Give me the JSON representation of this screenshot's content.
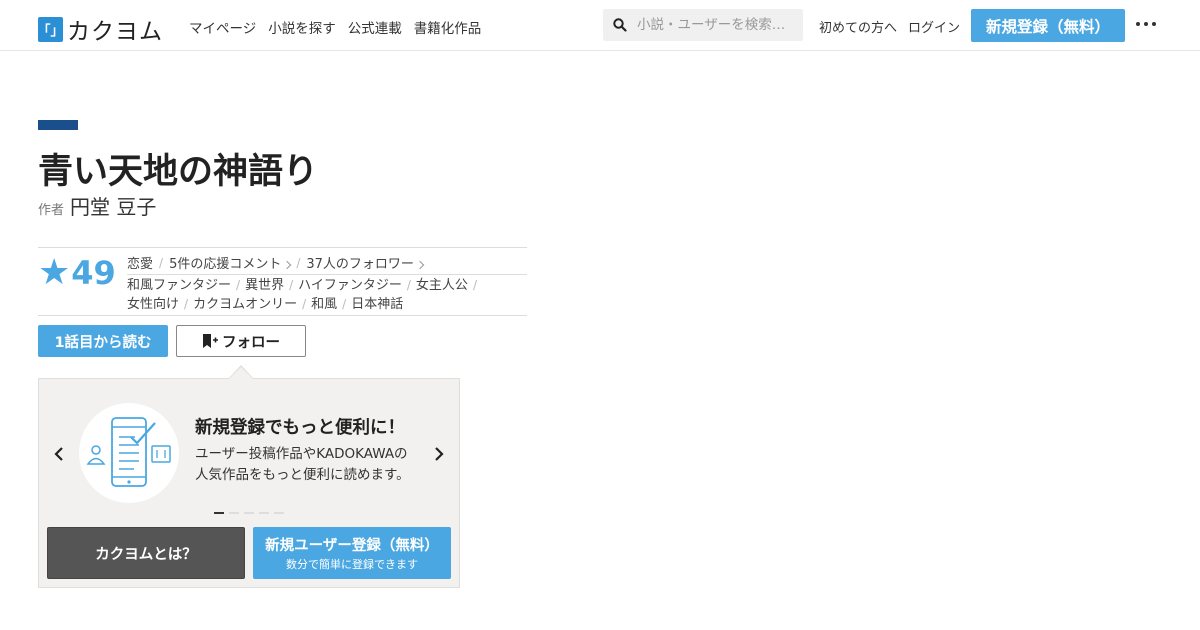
{
  "header": {
    "logo_mark": "「」",
    "logo_text": "カクヨム",
    "nav": [
      {
        "label": "マイページ"
      },
      {
        "label": "小説を探す"
      },
      {
        "label": "公式連載"
      },
      {
        "label": "書籍化作品"
      }
    ],
    "search_placeholder": "小説・ユーザーを検索…",
    "first_time": "初めての方へ",
    "login": "ログイン",
    "signup": "新規登録（無料）"
  },
  "work": {
    "title": "青い天地の神語り",
    "author_label": "作者",
    "author_name": "円堂 豆子",
    "star_count": "49",
    "genre": "恋愛",
    "comments": "5件の応援コメント",
    "followers": "37人のフォロワー",
    "tags": [
      "和風ファンタジー",
      "異世界",
      "ハイファンタジー",
      "女主人公",
      "女性向け",
      "カクヨムオンリー",
      "和風",
      "日本神話"
    ],
    "read_button": "1話目から読む",
    "follow_button": "フォロー"
  },
  "promo": {
    "title": "新規登録でもっと便利に！",
    "desc_line1": "ユーザー投稿作品やKADOKAWAの",
    "desc_line2": "人気作品をもっと便利に読めます。",
    "active_slide": 1,
    "slide_count": 5,
    "about_button": "カクヨムとは？",
    "register_main": "新規ユーザー登録（無料）",
    "register_sub": "数分で簡単に登録できます"
  },
  "colors": {
    "accent": "#4aa7e2",
    "brand_bar": "#1a4f8b",
    "dark_button": "#555555"
  }
}
